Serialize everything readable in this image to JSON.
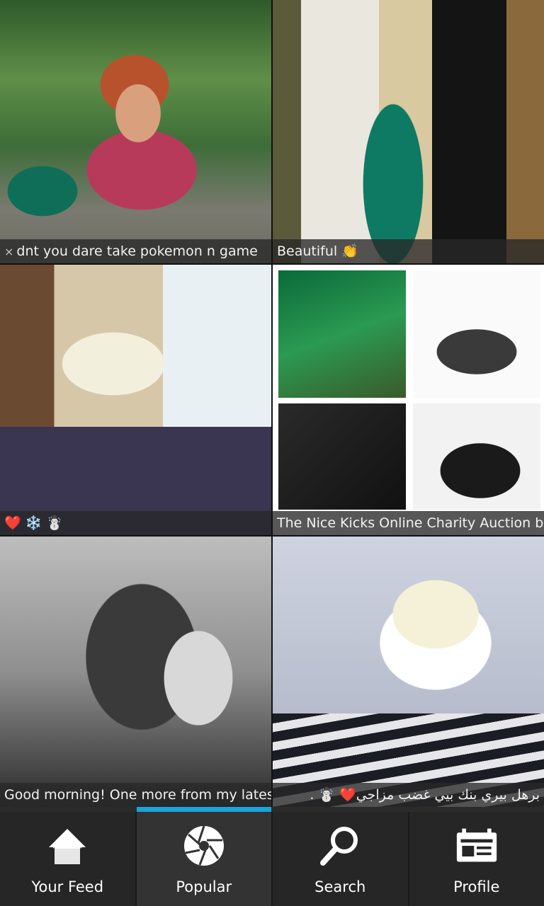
{
  "feed": {
    "tiles": [
      {
        "caption": "dnt you dare take pokemon n game",
        "glyph": "⨯"
      },
      {
        "caption": "Beautiful 👏"
      },
      {
        "caption": "❤️ ❄️ ☃️"
      },
      {
        "caption": "The Nice Kicks Online Charity Auction be"
      },
      {
        "caption": "Good morning! One more from my lates"
      },
      {
        "caption": "‏برهل بيري بنك بيي غضب مزاجي❤️ ☃️ ."
      }
    ]
  },
  "tabs": {
    "active_index": 1,
    "items": [
      {
        "label": "Your Feed",
        "icon": "home-icon"
      },
      {
        "label": "Popular",
        "icon": "aperture-icon"
      },
      {
        "label": "Search",
        "icon": "search-icon"
      },
      {
        "label": "Profile",
        "icon": "profile-card-icon"
      }
    ]
  },
  "colors": {
    "accent": "#1ba3dd",
    "nav_bg": "#262626"
  }
}
